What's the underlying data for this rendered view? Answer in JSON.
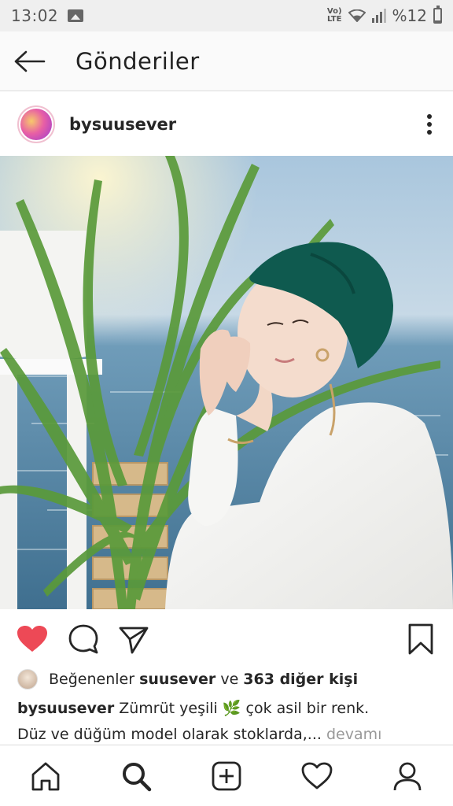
{
  "status_bar": {
    "time": "13:02",
    "network": "Vo)) LTE",
    "battery_text": "%12",
    "icons": [
      "gallery-icon",
      "wifi-icon",
      "signal-icon",
      "battery-icon"
    ]
  },
  "header": {
    "title": "Gönderiler",
    "back_icon": "arrow-left-icon"
  },
  "post": {
    "username": "bysuusever",
    "more_icon": "three-dots-vertical-icon",
    "liked": true,
    "colors": {
      "heart": "#ed4956",
      "turban": "#0f5a4f",
      "text_muted": "#999999"
    }
  },
  "likes": {
    "prefix": "Beğenenler ",
    "user": "suusever",
    "middle": " ve ",
    "count_text": "363 diğer kişi"
  },
  "caption": {
    "username": "bysuusever",
    "line1": " Zümrüt yeşili 🌿 çok asil bir renk.",
    "line2": "Düz ve düğüm model olarak stoklarda,...",
    "more": " devamı"
  },
  "bottom_nav": [
    "home-icon",
    "search-icon",
    "add-post-icon",
    "activity-heart-icon",
    "profile-icon"
  ]
}
